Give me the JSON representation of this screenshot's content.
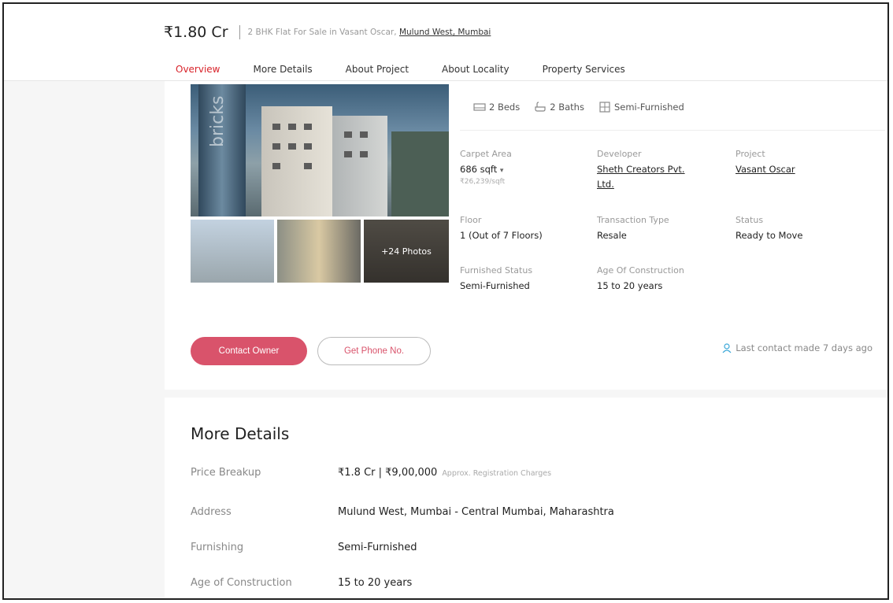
{
  "header": {
    "price": "₹1.80 Cr",
    "headline_prefix": "2 BHK Flat For Sale in Vasant Oscar,",
    "headline_location": "Mulund West, Mumbai"
  },
  "tabs": [
    {
      "label": "Overview",
      "active": true
    },
    {
      "label": "More Details"
    },
    {
      "label": "About Project"
    },
    {
      "label": "About Locality"
    },
    {
      "label": "Property Services"
    }
  ],
  "gallery": {
    "more_photos_label": "+24 Photos",
    "watermark": "bricks"
  },
  "amenities": {
    "beds": "2 Beds",
    "baths": "2 Baths",
    "furnishing": "Semi-Furnished"
  },
  "specs": {
    "carpet_area": {
      "label": "Carpet Area",
      "value": "686 sqft",
      "sub": "₹26,239/sqft"
    },
    "developer": {
      "label": "Developer",
      "value_line1": "Sheth Creators Pvt.",
      "value_line2": "Ltd."
    },
    "project": {
      "label": "Project",
      "value": "Vasant Oscar"
    },
    "floor": {
      "label": "Floor",
      "value": "1 (Out of 7 Floors)"
    },
    "transaction": {
      "label": "Transaction Type",
      "value": "Resale"
    },
    "status": {
      "label": "Status",
      "value": "Ready to Move"
    },
    "furnished": {
      "label": "Furnished Status",
      "value": "Semi-Furnished"
    },
    "age": {
      "label": "Age Of Construction",
      "value": "15 to 20 years"
    }
  },
  "actions": {
    "contact_owner": "Contact Owner",
    "get_phone": "Get Phone No.",
    "last_contact": "Last contact made 7 days ago"
  },
  "more_details": {
    "title": "More Details",
    "rows": [
      {
        "label": "Price Breakup",
        "value": "₹1.8 Cr | ₹9,00,000",
        "note": "Approx. Registration Charges"
      },
      {
        "label": "Address",
        "value": "Mulund West, Mumbai - Central Mumbai, Maharashtra"
      },
      {
        "label": "Furnishing",
        "value": "Semi-Furnished"
      },
      {
        "label": "Age of Construction",
        "value": "15 to 20 years"
      }
    ]
  },
  "colors": {
    "accent": "#d8232a",
    "button_primary": "#d9536b",
    "contact_icon": "#3aa7d8"
  },
  "icons": [
    "bed-icon",
    "bath-icon",
    "furniture-icon",
    "person-icon",
    "dropdown-caret-icon"
  ]
}
